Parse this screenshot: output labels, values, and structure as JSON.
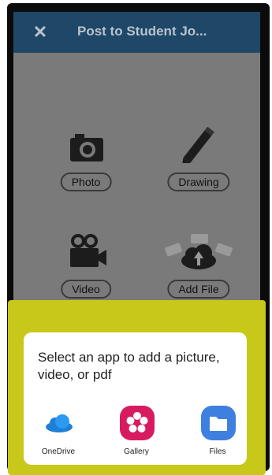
{
  "header": {
    "close_icon": "close-icon",
    "title": "Post to Student Jo..."
  },
  "options": [
    {
      "label": "Photo",
      "icon": "camera-icon"
    },
    {
      "label": "Drawing",
      "icon": "pencil-icon"
    },
    {
      "label": "Video",
      "icon": "video-camera-icon"
    },
    {
      "label": "Add File",
      "icon": "cloud-upload-icon"
    }
  ],
  "sheet": {
    "title": "Select an app to add a picture, video, or pdf",
    "apps": [
      {
        "label": "OneDrive",
        "icon": "onedrive-icon"
      },
      {
        "label": "Gallery",
        "icon": "gallery-icon"
      },
      {
        "label": "Files",
        "icon": "files-icon"
      }
    ]
  },
  "colors": {
    "header": "#1f4768",
    "highlight": "#c8c81a",
    "gallery": "#d81b60",
    "files": "#3f7fe0",
    "onedrive": "#1f7fd6"
  }
}
